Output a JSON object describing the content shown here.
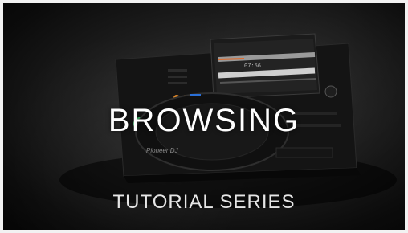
{
  "headline": "BROWSING",
  "subheadline": "TUTORIAL SERIES",
  "brand_marks": [
    "Pioneer DJ"
  ],
  "display_readout": "07:56",
  "colors": {
    "background": "#0b0b0b",
    "text": "#ffffff",
    "accent_orange": "#e0892a",
    "accent_blue": "#2a6fd6",
    "accent_green": "#47d47a"
  }
}
